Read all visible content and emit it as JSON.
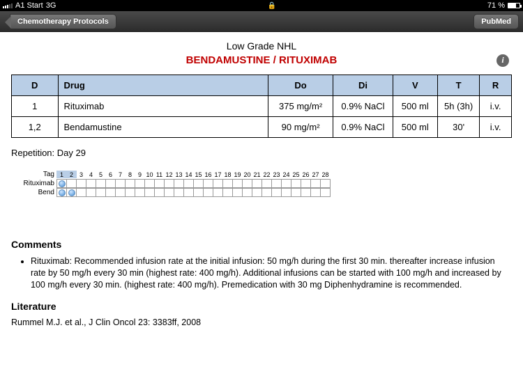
{
  "status_bar": {
    "carrier": "A1 Start",
    "network": "3G",
    "battery_text": "71 %"
  },
  "nav": {
    "back_label": "Chemotherapy Protocols",
    "right_label": "PubMed"
  },
  "header": {
    "subtitle": "Low Grade NHL",
    "title": "BENDAMUSTINE / RITUXIMAB"
  },
  "table": {
    "headers": {
      "d": "D",
      "drug": "Drug",
      "do": "Do",
      "di": "Di",
      "v": "V",
      "t": "T",
      "r": "R"
    },
    "rows": [
      {
        "d": "1",
        "drug": "Rituximab",
        "do": "375 mg/m²",
        "di": "0.9% NaCl",
        "v": "500 ml",
        "t": "5h (3h)",
        "r": "i.v."
      },
      {
        "d": "1,2",
        "drug": "Bendamustine",
        "do": "90 mg/m²",
        "di": "0.9% NaCl",
        "v": "500 ml",
        "t": "30'",
        "r": "i.v."
      }
    ]
  },
  "repetition": "Repetition: Day 29",
  "schedule": {
    "tag_label": "Tag",
    "days": [
      "1",
      "2",
      "3",
      "4",
      "5",
      "6",
      "7",
      "8",
      "9",
      "10",
      "11",
      "12",
      "13",
      "14",
      "15",
      "16",
      "17",
      "18",
      "19",
      "20",
      "21",
      "22",
      "23",
      "24",
      "25",
      "26",
      "27",
      "28"
    ],
    "highlight_days": [
      1,
      2
    ],
    "rows": [
      {
        "label": "Rituximab",
        "dose_days": [
          1
        ]
      },
      {
        "label": "Bend",
        "dose_days": [
          1,
          2
        ]
      }
    ]
  },
  "comments": {
    "heading": "Comments",
    "items": [
      "Rituximab: Recommended infusion rate at the initial infusion: 50 mg/h during the first 30 min. thereafter increase infusion rate by 50 mg/h every 30 min (highest rate: 400 mg/h). Additional infusions can be started with 100 mg/h and increased by 100 mg/h every 30 min. (highest rate: 400 mg/h). Premedication with 30 mg Diphenhydramine is recommended."
    ]
  },
  "literature": {
    "heading": "Literature",
    "text": "Rummel M.J. et al., J Clin Oncol 23: 3383ff, 2008"
  }
}
